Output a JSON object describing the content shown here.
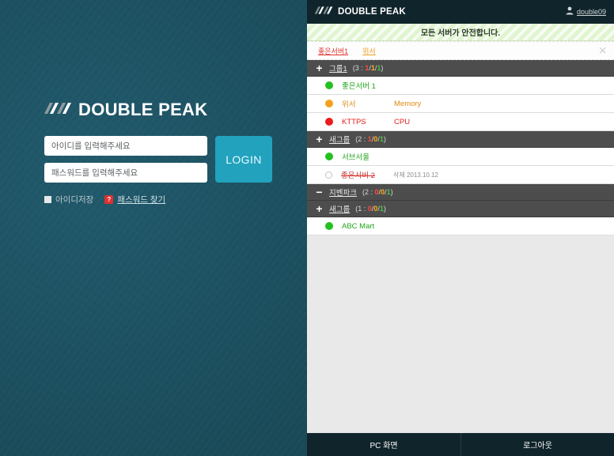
{
  "login": {
    "brand": "DOUBLE PEAK",
    "brand_mark": "double-peak-logo-icon",
    "id_placeholder": "아이디를 입력해주세요",
    "id_value": "",
    "pw_placeholder": "패스워드를 입력해주세요",
    "pw_value": "",
    "login_button": "LOGIN",
    "remember_label": "아이디저장",
    "remember_checked": false,
    "help_badge": "?",
    "find_password": "패스워드 찾기",
    "colors": {
      "background": "#1d5263",
      "button": "#22a2bd",
      "badge": "#e03030"
    }
  },
  "app": {
    "header": {
      "brand": "DOUBLE PEAK",
      "brand_mark": "double-peak-logo-icon",
      "user_icon": "user-icon",
      "user_name": "double09"
    },
    "status": {
      "text": "모든 서버가 안전합니다.",
      "color": "#dff5cf"
    },
    "tabs": {
      "items": [
        {
          "label": "좋은서버1",
          "color": "#e0322c"
        },
        {
          "label": "위서",
          "color": "#f0a022"
        }
      ],
      "close_icon": "close-icon"
    },
    "groups": [
      {
        "name": "그룹1",
        "toggle": "+",
        "expanded": true,
        "total": "3",
        "count_red": "1",
        "count_orange": "1",
        "count_green": "1",
        "servers": [
          {
            "status": "green",
            "name": "좋은서버 1",
            "metric": "",
            "meta": ""
          },
          {
            "status": "orange",
            "name": "위서",
            "metric": "Memory",
            "meta": ""
          },
          {
            "status": "red",
            "name": "KTTPS",
            "metric": "CPU",
            "meta": ""
          }
        ]
      },
      {
        "name": "새그룹",
        "toggle": "+",
        "expanded": true,
        "total": "2",
        "count_red": "1",
        "count_orange": "0",
        "count_green": "1",
        "servers": [
          {
            "status": "green",
            "name": "서브서울",
            "metric": "",
            "meta": ""
          },
          {
            "status": "deleted",
            "name": "좋은서버 2",
            "metric": "",
            "meta": "삭제 2013.10.12"
          }
        ]
      },
      {
        "name": "지벤파크",
        "toggle": "−",
        "expanded": false,
        "total": "2",
        "count_red": "0",
        "count_orange": "0",
        "count_green": "1",
        "servers": []
      },
      {
        "name": "새그룹",
        "toggle": "+",
        "expanded": true,
        "total": "1",
        "count_red": "0",
        "count_orange": "0",
        "count_green": "1",
        "servers": [
          {
            "status": "green",
            "name": "ABC Mart",
            "metric": "",
            "meta": ""
          }
        ]
      }
    ],
    "footer": {
      "pc_view": "PC 화면",
      "logout": "로그아웃"
    }
  }
}
